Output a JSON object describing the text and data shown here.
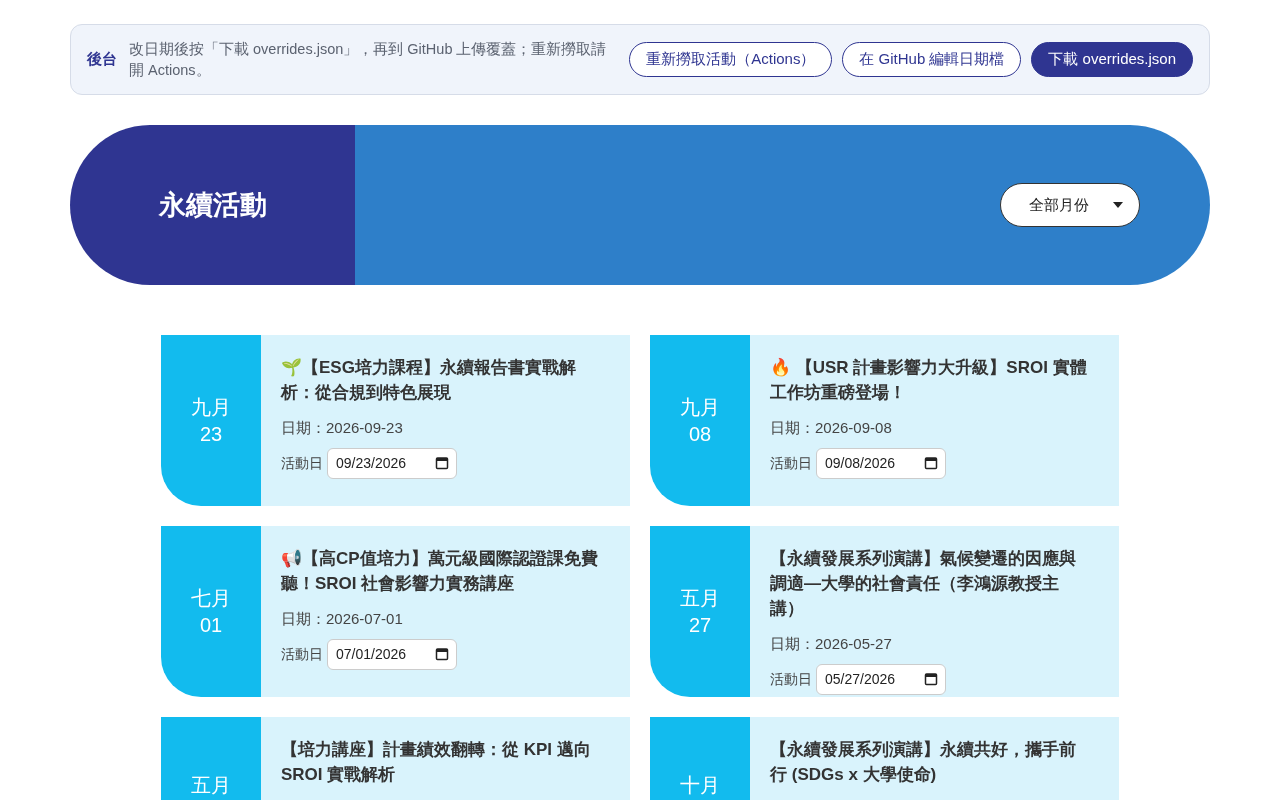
{
  "admin_bar": {
    "label": "後台",
    "note": "改日期後按「下載 overrides.json」，再到 GitHub 上傳覆蓋；重新撈取請開 Actions。",
    "buttons": [
      {
        "label": "重新撈取活動（Actions）",
        "kind": "outline"
      },
      {
        "label": "在 GitHub 編輯日期檔",
        "kind": "outline"
      },
      {
        "label": "下載 overrides.json",
        "kind": "filled"
      }
    ]
  },
  "banner": {
    "title": "永續活動",
    "month_filter": "全部月份"
  },
  "events": [
    {
      "month": "九月",
      "day": "23",
      "title": "🌱【ESG培力課程】永續報告書實戰解析：從合規到特色展現",
      "date_text": "日期：2026-09-23",
      "date_label": "活動日",
      "date_value": "09/23/2026"
    },
    {
      "month": "九月",
      "day": "08",
      "title": "🔥 【USR 計畫影響力大升級】SROI 實體工作坊重磅登場！",
      "date_text": "日期：2026-09-08",
      "date_label": "活動日",
      "date_value": "09/08/2026"
    },
    {
      "month": "七月",
      "day": "01",
      "title": "📢【高CP值培力】萬元級國際認證課免費聽！SROI 社會影響力實務講座",
      "date_text": "日期：2026-07-01",
      "date_label": "活動日",
      "date_value": "07/01/2026"
    },
    {
      "month": "五月",
      "day": "27",
      "title": "【永續發展系列演講】氣候變遷的因應與調適—大學的社會責任（李鴻源教授主講）",
      "date_text": "日期：2026-05-27",
      "date_label": "活動日",
      "date_value": "05/27/2026"
    },
    {
      "month": "五月",
      "title": "【培力講座】計畫績效翻轉：從 KPI 邁向 SROI 實戰解析"
    },
    {
      "month": "十月",
      "title": "【永續發展系列演講】永續共好，攜手前行 (SDGs x 大學使命)"
    }
  ]
}
